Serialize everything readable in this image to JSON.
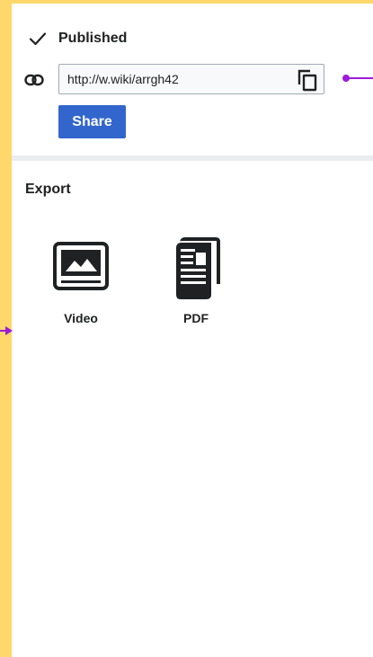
{
  "published": {
    "status_label": "Published",
    "check_icon": "check-icon"
  },
  "share_link": {
    "link_icon": "link-icon",
    "url": "http://w.wiki/arrgh42",
    "copy_icon": "copy-icon",
    "share_label": "Share",
    "accent_color": "#3366cc"
  },
  "export": {
    "title": "Export",
    "items": [
      {
        "label": "Video",
        "icon": "video-icon"
      },
      {
        "label": "PDF",
        "icon": "pdf-icon"
      }
    ]
  },
  "colors": {
    "frame": "#FFD86B",
    "annotation": "#9b1cd9",
    "divider": "#eaecf0"
  }
}
